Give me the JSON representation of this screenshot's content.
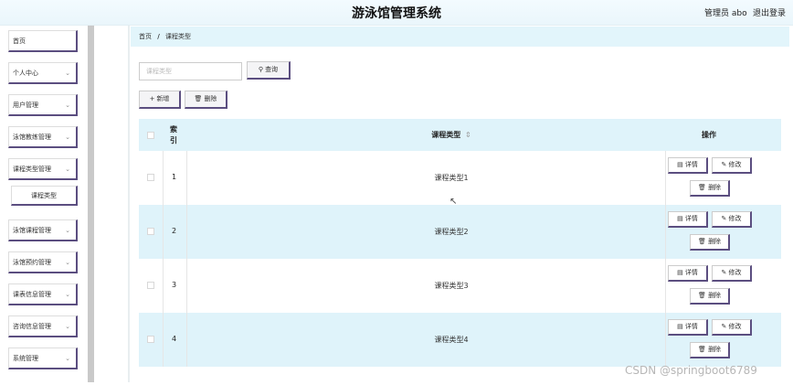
{
  "header": {
    "title": "游泳馆管理系统",
    "admin": "管理员 abo",
    "logout": "退出登录"
  },
  "sidebar": {
    "items": [
      {
        "label": "首页",
        "chevron": false
      },
      {
        "label": "个人中心",
        "chevron": true
      },
      {
        "label": "用户管理",
        "chevron": true
      },
      {
        "label": "泳馆教练管理",
        "chevron": true
      },
      {
        "label": "课程类型管理",
        "chevron": true
      },
      {
        "label": "泳馆课程管理",
        "chevron": true
      },
      {
        "label": "泳馆预约管理",
        "chevron": true
      },
      {
        "label": "课表信息管理",
        "chevron": true
      },
      {
        "label": "咨询信息管理",
        "chevron": true
      },
      {
        "label": "系统管理",
        "chevron": true
      }
    ],
    "sub_item": "课程类型",
    "chevron_glyph": "⌄"
  },
  "breadcrumb": {
    "home": "首页",
    "separator": "/",
    "current": "课程类型"
  },
  "search": {
    "placeholder": "课程类型",
    "button": "查询",
    "button_icon": "search-icon"
  },
  "toolbar": {
    "add": "新增",
    "add_icon": "plus-icon",
    "delete": "删除",
    "delete_icon": "trash-icon"
  },
  "table": {
    "headers": {
      "index": "索引",
      "name": "课程类型",
      "sort_icon": "⇕",
      "actions": "操作"
    },
    "rows": [
      {
        "index": "1",
        "name": "课程类型1"
      },
      {
        "index": "2",
        "name": "课程类型2"
      },
      {
        "index": "3",
        "name": "课程类型3"
      },
      {
        "index": "4",
        "name": "课程类型4"
      }
    ],
    "actions": {
      "detail": "详情",
      "edit": "修改",
      "delete": "删除"
    }
  },
  "watermark": "CSDN @springboot6789"
}
